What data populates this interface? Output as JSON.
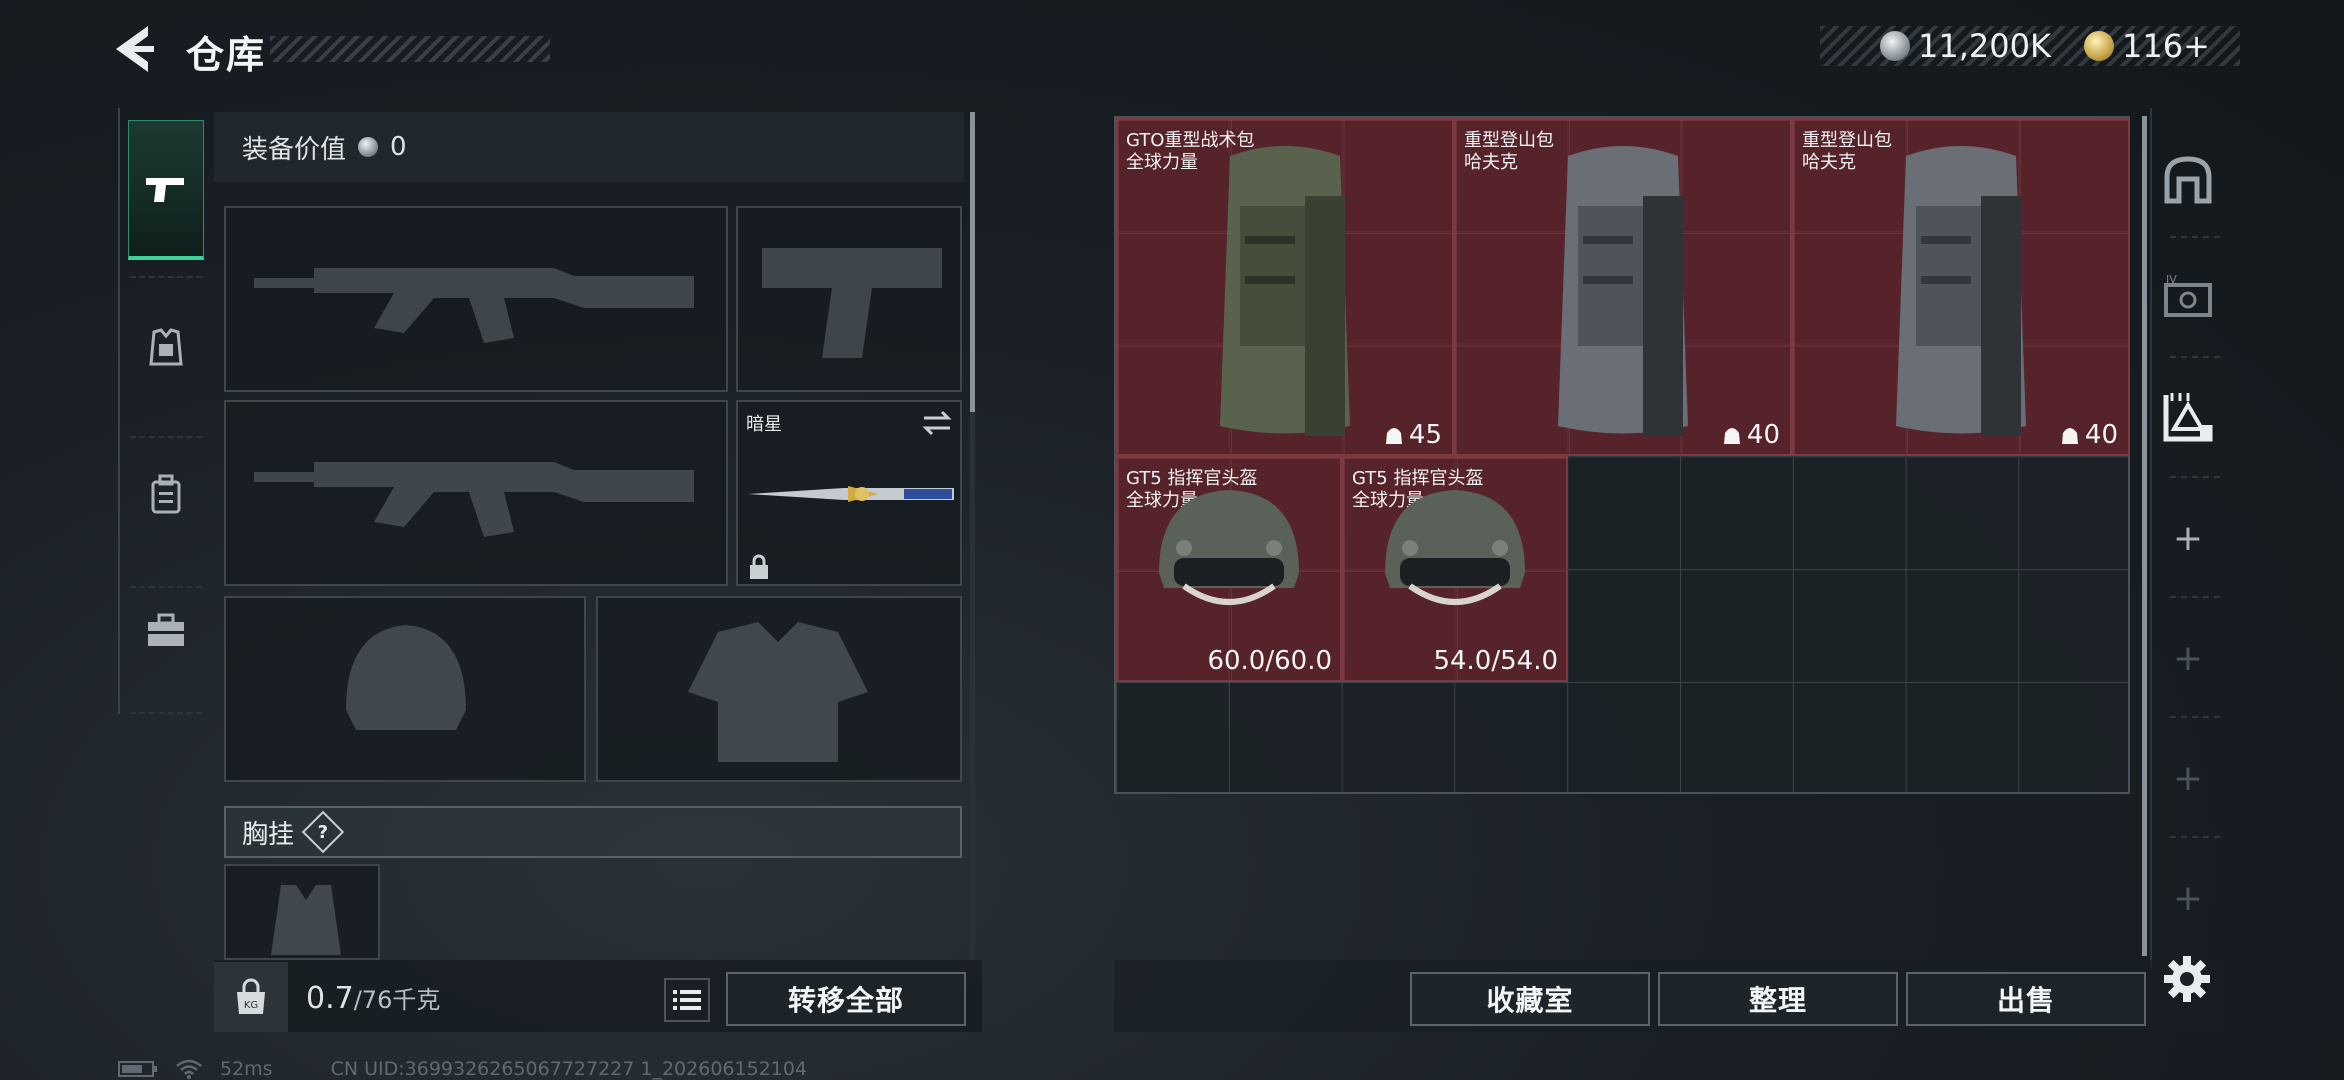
{
  "header": {
    "title": "仓库",
    "currency_silver": "11,200K",
    "currency_gold": "116+"
  },
  "loadout": {
    "equip_value_label": "装备价值",
    "equip_value": "0",
    "melee_slot_name": "暗星",
    "chest_label": "胸挂",
    "chest_help": "?"
  },
  "footer": {
    "weight_value": "0.7",
    "weight_capacity": "/76千克",
    "transfer_all": "转移全部",
    "collection_room": "收藏室",
    "organize": "整理",
    "sell": "出售"
  },
  "stash_items": [
    {
      "name": "GTO重型战术包",
      "sub": "全球力量",
      "capacity": "45"
    },
    {
      "name": "重型登山包",
      "sub": "哈夫克",
      "capacity": "40"
    },
    {
      "name": "重型登山包",
      "sub": "哈夫克",
      "capacity": "40"
    },
    {
      "name": "GT5 指挥官头盔",
      "sub": "全球力量",
      "durability": "60.0/60.0"
    },
    {
      "name": "GT5 指挥官头盔",
      "sub": "全球力量",
      "durability": "54.0/54.0"
    }
  ],
  "status": {
    "ping": "52ms",
    "uid": "CN UID:3699326265067727227 1_202606152104"
  },
  "icons": {
    "back": "back-chevron-icon",
    "pistol": "pistol-icon",
    "armor_vest": "vest-icon",
    "backpack": "backpack-icon",
    "toolbox": "toolbox-icon",
    "settings": "gear-icon"
  },
  "colors": {
    "item_bg": "#6e242c",
    "active_tab": "#3bd39a"
  }
}
